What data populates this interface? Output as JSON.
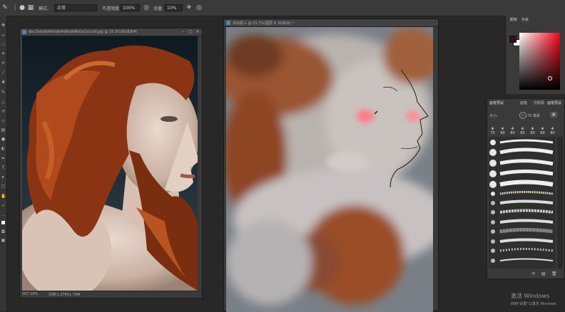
{
  "options_bar": {
    "mode_label": "模式:",
    "mode_value": "正常",
    "opacity_label": "不透明度:",
    "opacity_value": "100%",
    "flow_label": "流量:",
    "flow_value": "10%"
  },
  "reference_doc": {
    "title": "dbc7a0e8df4e58e4d6fa946d2e1e1c6f.jpg @ 33.3%(RGB/8#)",
    "zoom": "307.18%",
    "doc_info": "文档:1.37M/1.70M"
  },
  "painting_doc": {
    "title": "未标题-1 @ 33.7%(图层 4, RGB/8) *"
  },
  "color_panel": {
    "tab_color": "颜色",
    "tab_swatches": "色板",
    "foreground": "#3a0f14",
    "background": "#ffffff",
    "hue": "#ff0018"
  },
  "brush_panel": {
    "tab_1": "画笔预设",
    "tab_2": "画笔",
    "tab_3": "仿制源",
    "tab_4": "画笔预设",
    "size_label": "大小:",
    "size_value": "75 像素",
    "thumbs": [
      "75",
      "90",
      "60",
      "60",
      "60",
      "60",
      "60"
    ]
  },
  "watermark": {
    "line1": "激活 Windows",
    "line2": "转到\"设置\"以激活 Windows"
  }
}
